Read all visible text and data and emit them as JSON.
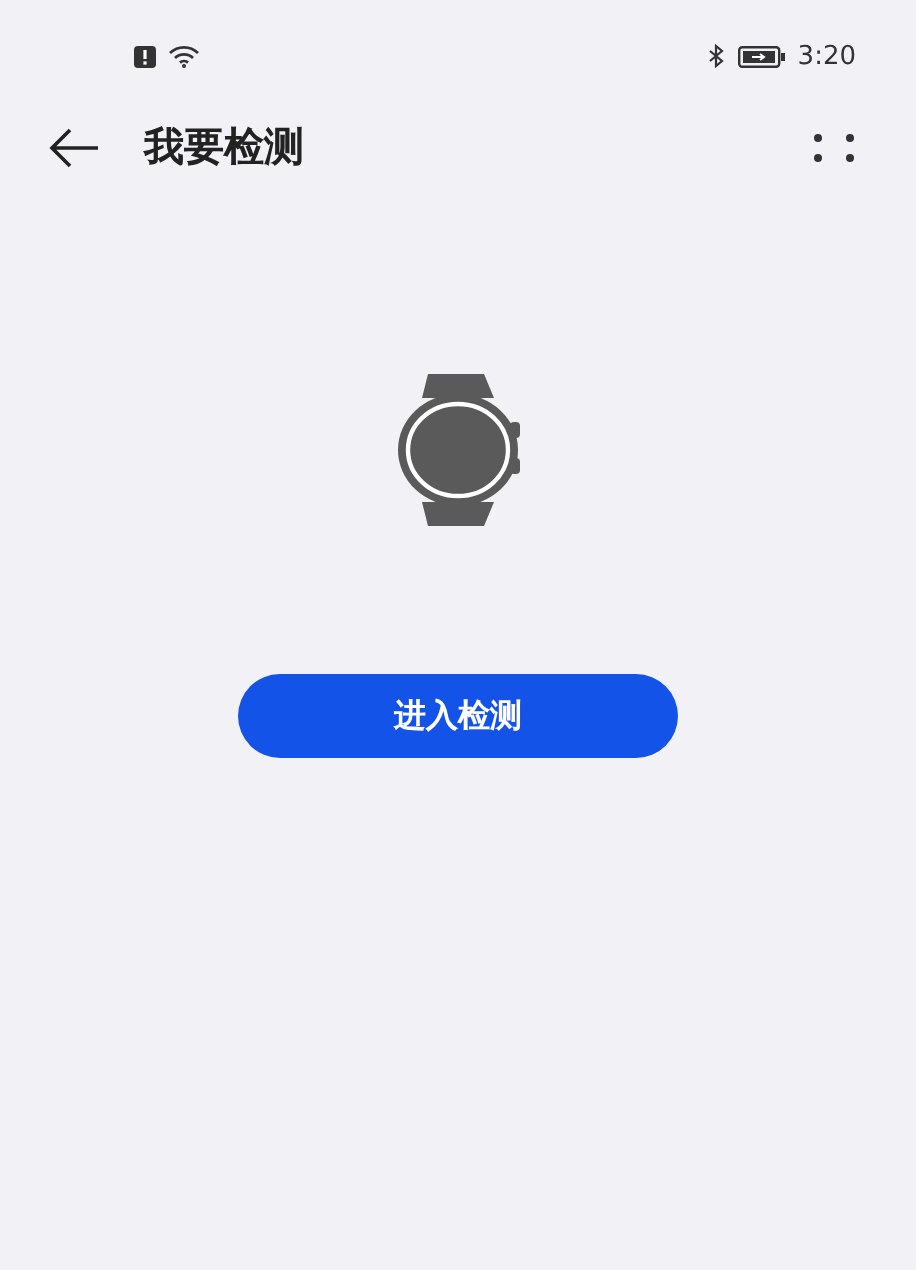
{
  "status_bar": {
    "time": "3:20"
  },
  "header": {
    "title": "我要检测"
  },
  "action_button": {
    "label": "进入检测"
  }
}
